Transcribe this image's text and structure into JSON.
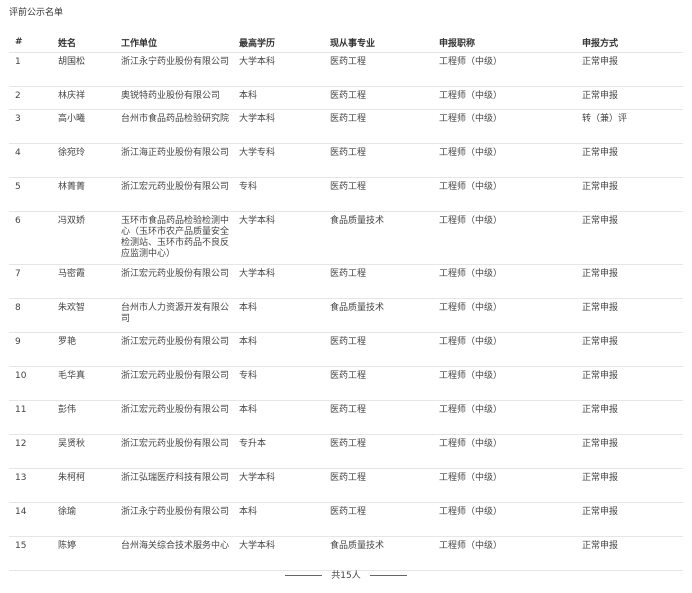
{
  "page_title": "评前公示名单",
  "columns": [
    "#",
    "姓名",
    "工作单位",
    "最高学历",
    "现从事专业",
    "申报职称",
    "申报方式"
  ],
  "rows": [
    {
      "idx": "1",
      "name": "胡国松",
      "org": "浙江永宁药业股份有限公司",
      "edu": "大学本科",
      "major": "医药工程",
      "title": "工程师（中级）",
      "mode": "正常申报"
    },
    {
      "idx": "2",
      "name": "林庆祥",
      "org": "奥锐特药业股份有限公司",
      "edu": "本科",
      "major": "医药工程",
      "title": "工程师（中级）",
      "mode": "正常申报"
    },
    {
      "idx": "3",
      "name": "高小曦",
      "org": "台州市食品药品检验研究院",
      "edu": "大学本科",
      "major": "医药工程",
      "title": "工程师（中级）",
      "mode": "转（兼）评"
    },
    {
      "idx": "4",
      "name": "徐宛玲",
      "org": "浙江海正药业股份有限公司",
      "edu": "大学专科",
      "major": "医药工程",
      "title": "工程师（中级）",
      "mode": "正常申报"
    },
    {
      "idx": "5",
      "name": "林菁菁",
      "org": "浙江宏元药业股份有限公司",
      "edu": "专科",
      "major": "医药工程",
      "title": "工程师（中级）",
      "mode": "正常申报"
    },
    {
      "idx": "6",
      "name": "冯双娇",
      "org": "玉环市食品药品检验检测中心（玉环市农产品质量安全检测站、玉环市药品不良反应监测中心）",
      "edu": "大学本科",
      "major": "食品质量技术",
      "title": "工程师（中级）",
      "mode": "正常申报"
    },
    {
      "idx": "7",
      "name": "马密霞",
      "org": "浙江宏元药业股份有限公司",
      "edu": "大学本科",
      "major": "医药工程",
      "title": "工程师（中级）",
      "mode": "正常申报"
    },
    {
      "idx": "8",
      "name": "朱欢智",
      "org": "台州市人力资源开发有限公司",
      "edu": "本科",
      "major": "食品质量技术",
      "title": "工程师（中级）",
      "mode": "正常申报"
    },
    {
      "idx": "9",
      "name": "罗艳",
      "org": "浙江宏元药业股份有限公司",
      "edu": "本科",
      "major": "医药工程",
      "title": "工程师（中级）",
      "mode": "正常申报"
    },
    {
      "idx": "10",
      "name": "毛华真",
      "org": "浙江宏元药业股份有限公司",
      "edu": "专科",
      "major": "医药工程",
      "title": "工程师（中级）",
      "mode": "正常申报"
    },
    {
      "idx": "11",
      "name": "彭伟",
      "org": "浙江宏元药业股份有限公司",
      "edu": "本科",
      "major": "医药工程",
      "title": "工程师（中级）",
      "mode": "正常申报"
    },
    {
      "idx": "12",
      "name": "吴贤秋",
      "org": "浙江宏元药业股份有限公司",
      "edu": "专升本",
      "major": "医药工程",
      "title": "工程师（中级）",
      "mode": "正常申报"
    },
    {
      "idx": "13",
      "name": "朱柯柯",
      "org": "浙江弘瑞医疗科技有限公司",
      "edu": "大学本科",
      "major": "医药工程",
      "title": "工程师（中级）",
      "mode": "正常申报"
    },
    {
      "idx": "14",
      "name": "徐瑜",
      "org": "浙江永宁药业股份有限公司",
      "edu": "本科",
      "major": "医药工程",
      "title": "工程师（中级）",
      "mode": "正常申报"
    },
    {
      "idx": "15",
      "name": "陈婷",
      "org": "台州海关综合技术服务中心",
      "edu": "大学本科",
      "major": "食品质量技术",
      "title": "工程师（中级）",
      "mode": "正常申报"
    }
  ],
  "footer_total": "共15人"
}
